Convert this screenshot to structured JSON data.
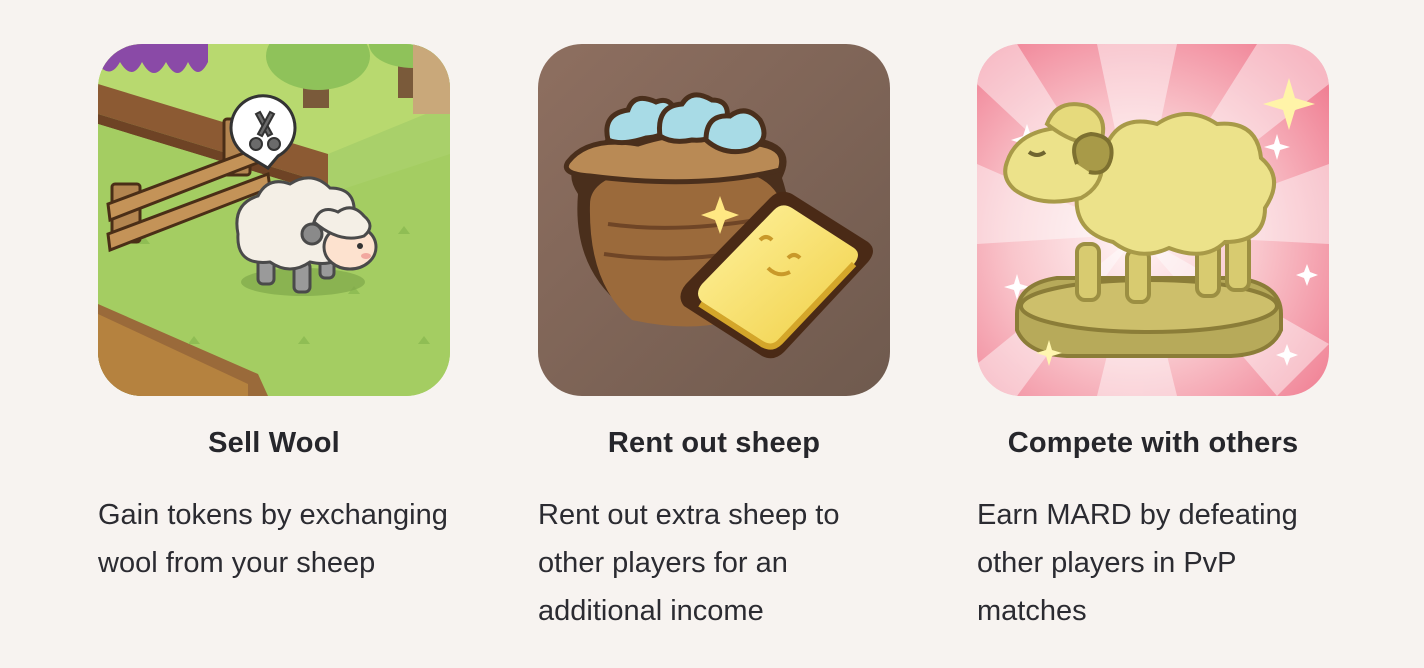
{
  "features": [
    {
      "title": "Sell Wool",
      "description": "Gain tokens by exchanging wool from your sheep",
      "image_icon": "sheep-in-pasture-icon"
    },
    {
      "title": "Rent out sheep",
      "description": "Rent out extra sheep to other players for an additional income",
      "image_icon": "gold-bar-and-wool-sack-icon"
    },
    {
      "title": "Compete with others",
      "description": "Earn MARD by defeating other players in PvP matches",
      "image_icon": "golden-sheep-trophy-icon"
    }
  ]
}
